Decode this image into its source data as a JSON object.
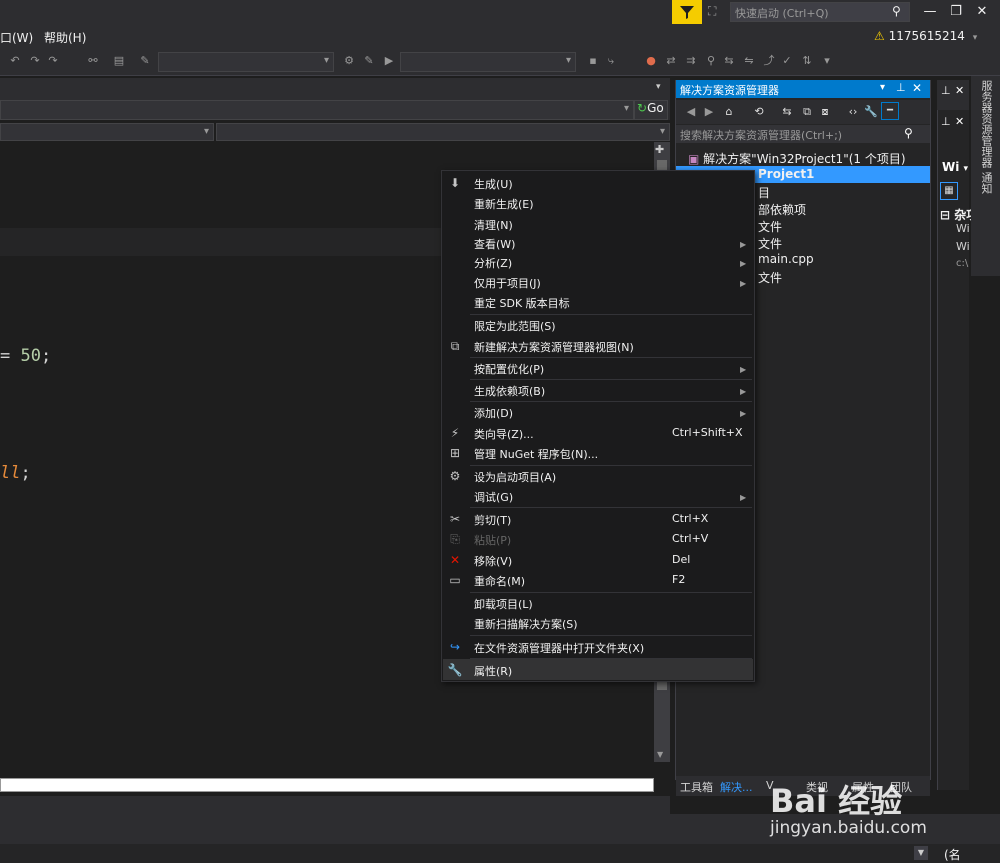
{
  "titlebar": {
    "quick_launch_placeholder": "快速启动 (Ctrl+Q)",
    "minimize": "—",
    "maximize": "❐",
    "close": "✕"
  },
  "menubar": {
    "items": [
      "口(W)",
      "帮助(H)"
    ],
    "user": "1175615214",
    "warning_icon": "warning-icon"
  },
  "toolbar": {
    "go_label": "Go"
  },
  "editor": {
    "code_line1_op": "= ",
    "code_line1_num": "50",
    "code_line1_end": ";",
    "code_line2_kw": "ll",
    "code_line2_end": ";"
  },
  "solution_explorer": {
    "title": "解决方案资源管理器",
    "search_placeholder": "搜索解决方案资源管理器(Ctrl+;)",
    "tree": [
      "解决方案\"Win32Project1\"(1 个项目)",
      "Project1",
      "目",
      "部依赖项",
      "文件",
      "文件",
      "main.cpp",
      "文件"
    ],
    "tabs": [
      "工具箱",
      "解决...",
      "V",
      "类视",
      "属性",
      "团队"
    ]
  },
  "right_panel": {
    "dropdown": "Wi",
    "section": "杂项",
    "rows": [
      "Wi",
      "Wi",
      "c:\\"
    ],
    "bottom": "(名"
  },
  "vertical_tabs": [
    "服务器资源管理器",
    "通知"
  ],
  "context_menu": {
    "items": [
      {
        "label": "生成(U)",
        "icon": "build-icon"
      },
      {
        "label": "重新生成(E)"
      },
      {
        "label": "清理(N)"
      },
      {
        "label": "查看(W)",
        "submenu": true
      },
      {
        "label": "分析(Z)",
        "submenu": true
      },
      {
        "label": "仅用于项目(J)",
        "submenu": true
      },
      {
        "label": "重定 SDK 版本目标"
      },
      {
        "label": "限定为此范围(S)"
      },
      {
        "label": "新建解决方案资源管理器视图(N)",
        "icon": "new-view-icon"
      },
      {
        "label": "按配置优化(P)",
        "submenu": true
      },
      {
        "label": "生成依赖项(B)",
        "submenu": true
      },
      {
        "label": "添加(D)",
        "submenu": true
      },
      {
        "label": "类向导(Z)...",
        "shortcut": "Ctrl+Shift+X",
        "icon": "class-wizard-icon"
      },
      {
        "label": "管理 NuGet 程序包(N)...",
        "icon": "nuget-icon"
      },
      {
        "label": "设为启动项目(A)",
        "icon": "gear-icon"
      },
      {
        "label": "调试(G)",
        "submenu": true
      },
      {
        "label": "剪切(T)",
        "shortcut": "Ctrl+X",
        "icon": "scissors-icon"
      },
      {
        "label": "粘贴(P)",
        "shortcut": "Ctrl+V",
        "icon": "paste-icon",
        "disabled": true
      },
      {
        "label": "移除(V)",
        "shortcut": "Del",
        "icon": "remove-icon"
      },
      {
        "label": "重命名(M)",
        "shortcut": "F2",
        "icon": "rename-icon"
      },
      {
        "label": "卸载项目(L)"
      },
      {
        "label": "重新扫描解决方案(S)"
      },
      {
        "label": "在文件资源管理器中打开文件夹(X)",
        "icon": "open-folder-icon"
      },
      {
        "label": "属性(R)",
        "icon": "wrench-icon"
      }
    ]
  },
  "watermark": {
    "logo": "Bai 经验",
    "url": "jingyan.baidu.com"
  }
}
